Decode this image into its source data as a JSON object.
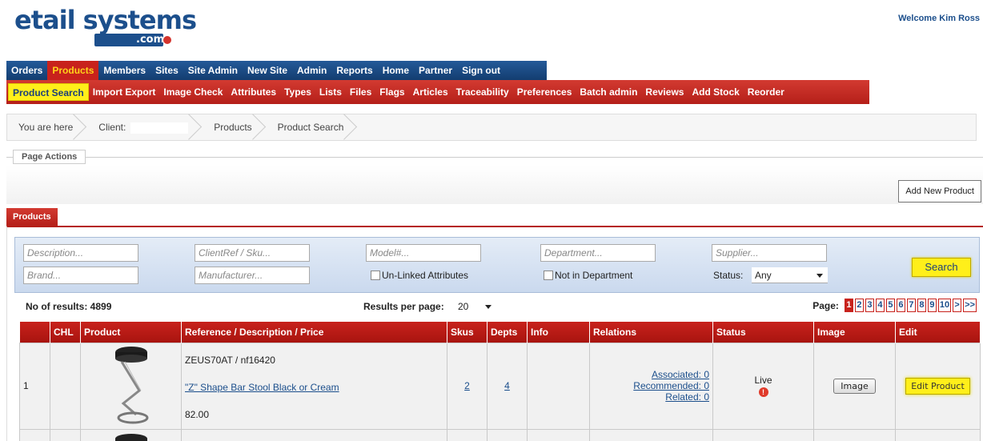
{
  "header": {
    "logo_main": "etail systems",
    "logo_sub": ".com",
    "welcome": "Welcome Kim Ross"
  },
  "main_nav": [
    "Orders",
    "Products",
    "Members",
    "Sites",
    "Site Admin",
    "New Site",
    "Admin",
    "Reports",
    "Home",
    "Partner",
    "Sign out"
  ],
  "main_nav_active": "Products",
  "sub_nav": [
    "Product Search",
    "Import Export",
    "Image Check",
    "Attributes",
    "Types",
    "Lists",
    "Files",
    "Flags",
    "Articles",
    "Traceability",
    "Preferences",
    "Batch admin",
    "Reviews",
    "Add Stock",
    "Reorder"
  ],
  "sub_nav_active": "Product Search",
  "breadcrumb": {
    "here": "You are here",
    "client": "Client:",
    "products": "Products",
    "product_search": "Product Search"
  },
  "page_actions": {
    "legend": "Page Actions",
    "add_button": "Add New Product"
  },
  "products_tab": "Products",
  "search": {
    "description": "Description...",
    "clientref": "ClientRef / Sku...",
    "model": "Model#...",
    "department": "Department...",
    "supplier": "Supplier...",
    "brand": "Brand...",
    "manufacturer": "Manufacturer...",
    "unlinked": "Un-Linked Attributes",
    "not_in_dept": "Not in Department",
    "status_label": "Status:",
    "status_value": "Any",
    "search_button": "Search"
  },
  "results": {
    "count_label": "No of results: 4899",
    "per_page_label": "Results per page:",
    "per_page_value": "20",
    "page_label": "Page:",
    "pages": [
      "1",
      "2",
      "3",
      "4",
      "5",
      "6",
      "7",
      "8",
      "9",
      "10",
      ">",
      ">>"
    ],
    "active_page": "1"
  },
  "table": {
    "headers": {
      "num": "",
      "chl": "CHL",
      "product": "Product",
      "reference": "Reference / Description / Price",
      "skus": "Skus",
      "depts": "Depts",
      "info": "Info",
      "relations": "Relations",
      "status": "Status",
      "image": "Image",
      "edit": "Edit"
    },
    "rows": [
      {
        "num": "1",
        "code": "ZEUS70AT / nf16420",
        "description": "\"Z\" Shape Bar Stool Black or Cream",
        "price": "82.00",
        "skus": "2",
        "depts": "4",
        "associated": "Associated: 0",
        "recommended": "Recommended: 0",
        "related": "Related: 0",
        "status": "Live",
        "image_button": "Image",
        "edit_button": "Edit Product"
      }
    ]
  },
  "colors": {
    "nav_blue": "#1c4f8c",
    "nav_red": "#c8221c",
    "highlight_yellow": "#ffef1a"
  }
}
